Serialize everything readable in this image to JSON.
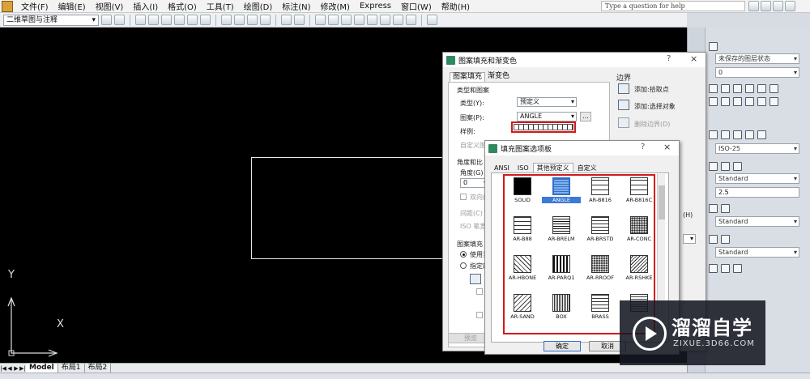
{
  "menubar": {
    "items": [
      "文件(F)",
      "编辑(E)",
      "视图(V)",
      "插入(I)",
      "格式(O)",
      "工具(T)",
      "绘图(D)",
      "标注(N)",
      "修改(M)",
      "Express",
      "窗口(W)",
      "帮助(H)"
    ],
    "help_search": "Type a question for help"
  },
  "toolbar": {
    "workspace": "二维草图与注释"
  },
  "model_tabs": [
    "Model",
    "布局1",
    "布局2"
  ],
  "ucs": {
    "x_label": "X",
    "y_label": "Y"
  },
  "palette": {
    "layer_state": "未保存的图层状态",
    "layer_value": "0",
    "dim_style": "ISO-25",
    "text_style": "Standard",
    "text_height": "2.5",
    "table_style": "Standard",
    "mleader_style": "Standard"
  },
  "hatch_dialog": {
    "title": "图案填充和渐变色",
    "qmark": "?",
    "close": "×",
    "tabs": [
      "图案填充",
      "渐变色"
    ],
    "type_group": "类型和图案",
    "type_label": "类型(Y):",
    "type_value": "预定义",
    "pattern_label": "图案(P):",
    "pattern_value": "ANGLE",
    "browse": "...",
    "swatch_label": "样例:",
    "custom_label": "自定义图",
    "angle_group": "角度和比",
    "angle_label": "角度(G)",
    "angle_value": "0",
    "double_label": "双向(",
    "spacing_label": "间距(C)",
    "iso_label": "ISO 笔宽",
    "origin_group": "图案填充",
    "origin_use": "使用当",
    "origin_specify": "指定的",
    "default_label": "默",
    "store_label": "存",
    "preview": "预览",
    "boundary": "边界",
    "add_pick": "添加:拾取点",
    "add_select": "添加:选择对象",
    "remove_boundary": "删除边界(D)",
    "h_shortcut": "(H)"
  },
  "palette_dialog": {
    "title": "填充图案选项板",
    "qmark": "?",
    "close": "×",
    "tabs": [
      "ANSI",
      "ISO",
      "其他预定义",
      "自定义"
    ],
    "patterns": [
      "SOLID",
      "ANGLE",
      "AR-B816",
      "AR-B816C",
      "AR-B88",
      "AR-BRELM",
      "AR-BRSTD",
      "AR-CONC",
      "AR-HBONE",
      "AR-PARQ1",
      "AR-RROOF",
      "AR-RSHKE",
      "AR-SAND",
      "BOX",
      "BRASS",
      ""
    ],
    "selected": "ANGLE",
    "ok": "确定",
    "cancel": "取消"
  },
  "watermark": {
    "title": "溜溜自学",
    "url": "ZIXUE.3D66.COM"
  },
  "colors": {
    "canvas": "#000000",
    "highlight": "#d21a1a",
    "selection": "#3a7bd5"
  }
}
